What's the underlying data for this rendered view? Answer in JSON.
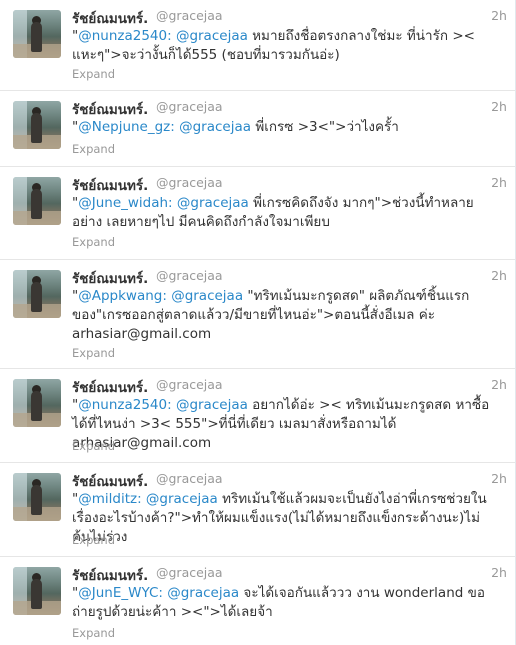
{
  "tweets": [
    {
      "fullname": "รัชย์ณมนทร์.",
      "username": "@gracejaa",
      "time": "2h",
      "mentions": "@nunza2540: @gracejaa",
      "text": " หมายถึงชื่อตรงกลางใช่มะ ที่น่ารัก >< แหะๆ\">จะว่างั้นก็ได้555 (ชอบที่มารวมกันอ่ะ)",
      "expand": "Expand"
    },
    {
      "fullname": "รัชย์ณมนทร์.",
      "username": "@gracejaa",
      "time": "2h",
      "mentions": "@Nepjune_gz: @gracejaa",
      "text": " พี่เกรซ >3<\">ว่าไงครั้า",
      "expand": "Expand"
    },
    {
      "fullname": "รัชย์ณมนทร์.",
      "username": "@gracejaa",
      "time": "2h",
      "mentions": "@June_widah: @gracejaa",
      "text": " พี่เกรซคิดถึงจัง มากๆ\">ช่วงนี้ทำหลายอย่าง เลยหายๆไป มีคนคิดถึงกำลังใจมาเพียบ",
      "expand": "Expand"
    },
    {
      "fullname": "รัชย์ณมนทร์.",
      "username": "@gracejaa",
      "time": "2h",
      "mentions": "@Appkwang: @gracejaa",
      "text": " \"ทริทเม้นมะกรูดสด\" ผลิตภัณฑ์ชิ้นแรกของ\"เกรซออกสู่ตลาดแล้วว/มีขายที่ไหนอ่ะ\">ตอนนี้สั่งอีเมล ค่ะ arhasiar@gmail.com",
      "expand": "Expand"
    },
    {
      "fullname": "รัชย์ณมนทร์.",
      "username": "@gracejaa",
      "time": "2h",
      "mentions": "@nunza2540: @gracejaa",
      "text": " อยากได้อ่ะ >< ทริทเม้นมะกรูดสด หาซื้อได้ที่ไหนง่า >3< 555\">ที่นี่ที่เดียว เมลมาสั่งหรือถามได้ arhasiar@gmail.com",
      "expand": "Expand"
    },
    {
      "fullname": "รัชย์ณมนทร์.",
      "username": "@gracejaa",
      "time": "2h",
      "mentions": "@milditz: @gracejaa",
      "text": " ทริทเม้นใช้แล้วผมจะเป็นยังไงอ่าพี่เกรซช่วยในเรื่องอะไรบ้างค้า?\">ทำให้ผมแข็งแรง(ไม่ได้หมายถึงแข็งกระด้างนะ)ไม่ค้นไม่ร่วง",
      "expand": "Expand"
    },
    {
      "fullname": "รัชย์ณมนทร์.",
      "username": "@gracejaa",
      "time": "2h",
      "mentions": "@JunE_WYC: @gracejaa",
      "text": " จะได้เจอกันแล้ววว งาน wonderland ขอถ่ายรูปด้วยน่ะค้าา ><\">ได้เลยจ้า",
      "expand": "Expand"
    }
  ]
}
